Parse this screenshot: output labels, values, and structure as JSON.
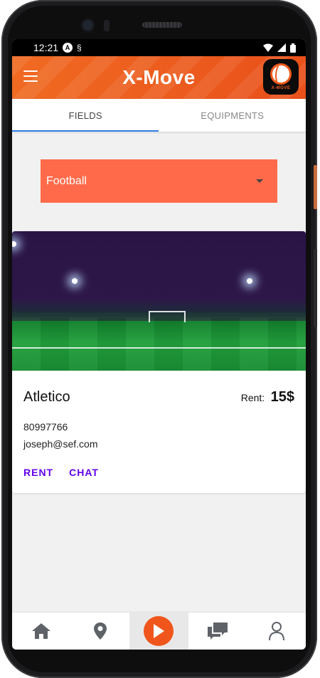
{
  "status_bar": {
    "time": "12:21"
  },
  "app_bar": {
    "title": "X-Move",
    "logo_text": "X-MOVE"
  },
  "tabs": [
    {
      "label": "FIELDS",
      "active": true
    },
    {
      "label": "EQUIPMENTS",
      "active": false
    }
  ],
  "sport_select": {
    "value": "Football"
  },
  "card": {
    "name": "Atletico",
    "rent_label": "Rent:",
    "rent_value": "15$",
    "phone": "80997766",
    "email": "joseph@sef.com",
    "actions": [
      "RENT",
      "CHAT"
    ]
  },
  "bottom_nav": {
    "items": [
      "home-icon",
      "location-pin-icon",
      "play-icon",
      "chat-icon",
      "profile-icon"
    ],
    "active_index": 2
  },
  "colors": {
    "accent": "#ef5a1c",
    "select_bg": "#ff6b4a",
    "tab_indicator": "#2f80e8",
    "action": "#6200ee"
  }
}
